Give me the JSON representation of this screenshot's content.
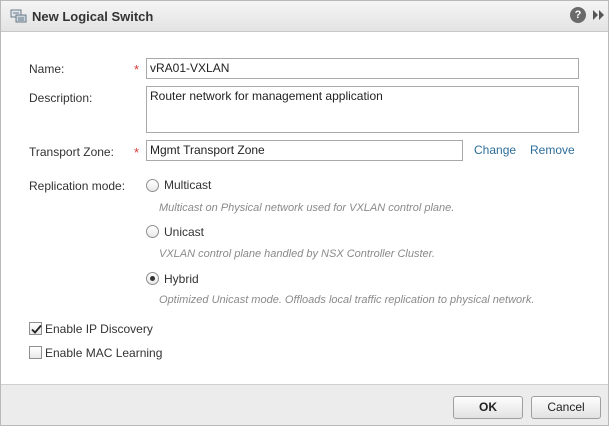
{
  "window": {
    "title": "New Logical Switch",
    "help_glyph": "?"
  },
  "form": {
    "name": {
      "label": "Name:",
      "value": "vRA01-VXLAN",
      "required_mark": "*"
    },
    "description": {
      "label": "Description:",
      "value": "Router network for management application"
    },
    "transport_zone": {
      "label": "Transport Zone:",
      "value": "Mgmt Transport Zone",
      "required_mark": "*",
      "change_label": "Change",
      "remove_label": "Remove"
    },
    "replication_mode": {
      "label": "Replication mode:",
      "selected": "Hybrid",
      "options": [
        {
          "label": "Multicast",
          "hint": "Multicast on Physical network used for VXLAN control plane."
        },
        {
          "label": "Unicast",
          "hint": "VXLAN control plane handled by NSX Controller Cluster."
        },
        {
          "label": "Hybrid",
          "hint": "Optimized Unicast mode. Offloads local traffic replication to physical network."
        }
      ]
    },
    "enable_ip_discovery": {
      "label": "Enable IP Discovery",
      "checked": true
    },
    "enable_mac_learning": {
      "label": "Enable MAC Learning",
      "checked": false
    }
  },
  "footer": {
    "ok_label": "OK",
    "cancel_label": "Cancel"
  },
  "colors": {
    "required": "#d83a3a",
    "link": "#2d6d99",
    "hint": "#8a8a8a"
  },
  "icons": {
    "title": "logical-switch-icon",
    "help": "help-icon",
    "expand": "expand-icon"
  }
}
